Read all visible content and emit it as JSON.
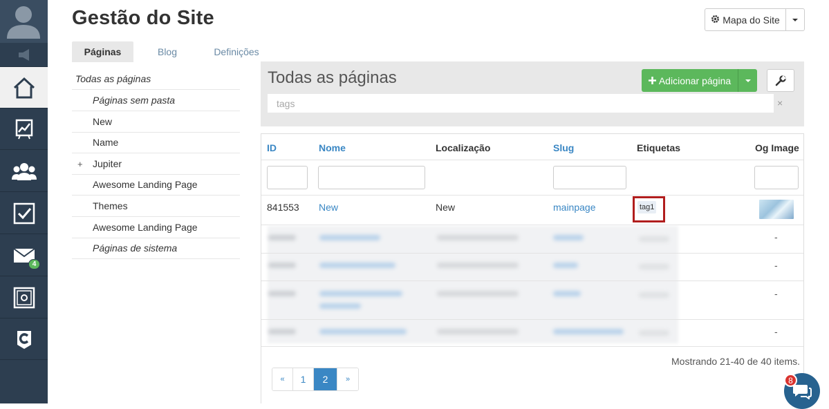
{
  "page": {
    "title": "Gestão do Site"
  },
  "header": {
    "sitemap_label": "Mapa do Site"
  },
  "tabs": [
    {
      "label": "Páginas",
      "active": true
    },
    {
      "label": "Blog",
      "active": false
    },
    {
      "label": "Definições",
      "active": false
    }
  ],
  "sidebar": {
    "items": [
      "avatar-icon",
      "megaphone-icon",
      "home-icon",
      "chart-icon",
      "users-icon",
      "checkbox-icon",
      "mail-icon",
      "vault-icon",
      "c-logo-icon"
    ],
    "mail_badge": "4"
  },
  "tree": [
    {
      "label": "Todas as páginas",
      "italic": true
    },
    {
      "label": "Páginas sem pasta",
      "italic": true
    },
    {
      "label": "New",
      "italic": false
    },
    {
      "label": "Name",
      "italic": false
    },
    {
      "label": "Jupiter",
      "italic": false,
      "expandable": "+"
    },
    {
      "label": "Awesome Landing Page",
      "italic": false
    },
    {
      "label": "Themes",
      "italic": false
    },
    {
      "label": "Awesome Landing Page",
      "italic": false
    },
    {
      "label": "Páginas de sistema",
      "italic": true
    }
  ],
  "panel": {
    "title": "Todas as páginas",
    "add_label": "Adicionar página",
    "tags_placeholder": "tags",
    "clear_symbol": "×"
  },
  "table": {
    "columns": [
      "ID",
      "Nome",
      "Localização",
      "Slug",
      "Etiquetas",
      "Og Image"
    ],
    "first_row": {
      "id": "841553",
      "nome": "New",
      "localizacao": "New",
      "slug": "mainpage",
      "tag": "tag1"
    },
    "og_placeholder": "-"
  },
  "pagination": {
    "showing": "Mostrando 21-40 de 40 items.",
    "prev": "«",
    "pages": [
      "1",
      "2"
    ],
    "current": "2",
    "next": "»"
  },
  "chat": {
    "badge": "8"
  },
  "colors": {
    "sidebar": "#2d3e50",
    "link": "#3a87c4",
    "primary_green": "#5cb85c",
    "highlight": "#b11d1d"
  }
}
